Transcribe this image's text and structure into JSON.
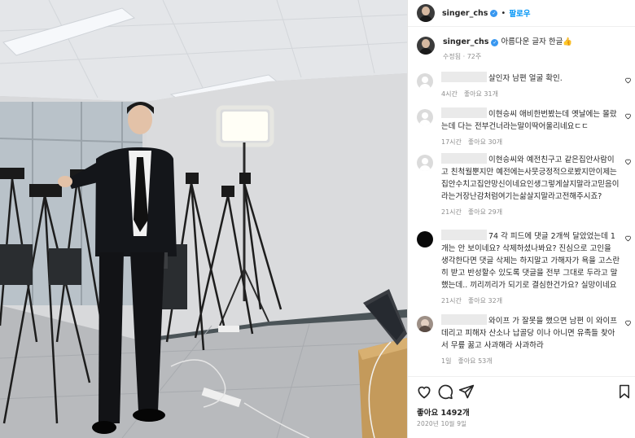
{
  "post": {
    "username": "singer_chs",
    "follow_label": "팔로우",
    "caption": "아름다운 글자 한글👍",
    "caption_meta": "수정됨 · 72주",
    "likes": "좋아요 1492개",
    "date": "2020년 10월 9일"
  },
  "comments": [
    {
      "text": "살인자 남편 얼굴 확인.",
      "time": "4시간",
      "likes": "좋아요 31개",
      "avatar": "generic"
    },
    {
      "text": "이현승씨 애비한번봤는데 옛날에는 몰랐는데 다는 전부건너라는말이딱어울리네요ㄷㄷ",
      "time": "17시간",
      "likes": "좋아요 30개",
      "avatar": "generic"
    },
    {
      "text": "이현승씨와 예전친구고 같은집안사람이고 친척월뿐지만 예전에는사뭇긍정적으로봤지만이제는집안수치고집안망신이네요인생그렇게살지말라고믿음이라는거장난감처럼여기는삶살지말라고전해주시죠?",
      "time": "21시간",
      "likes": "좋아요 29개",
      "avatar": "generic"
    },
    {
      "text": "74 각 피드에 댓글 2개씩 달았었는데 1개는 안 보이네요? 삭제하셨나봐요? 진심으로 고인을 생각한다면 댓글 삭제는 하지말고 가해자가 욕을 고스란히 받고 반성할수 있도록 댓글을 전부 그대로 두라고 말했는데.. 끼리끼리가 되기로 결심한건가요? 실망이네요",
      "time": "21시간",
      "likes": "좋아요 32개",
      "avatar": "black"
    },
    {
      "text": "와이프 가 잘못을 했으면 남편 이 와이프 데리고 피해자 산소나 납골당 이나 아니면 유족들 찾아서 무릎 꿇고 사과해라 사과하라",
      "time": "1일",
      "likes": "좋아요 53개",
      "avatar": "photo"
    }
  ],
  "icons": [
    "heart-icon",
    "comment-icon",
    "share-icon",
    "bookmark-icon",
    "verified-icon"
  ],
  "colors": {
    "link": "#0095f6",
    "verified": "#3897f0",
    "meta": "#8e8e8e"
  }
}
